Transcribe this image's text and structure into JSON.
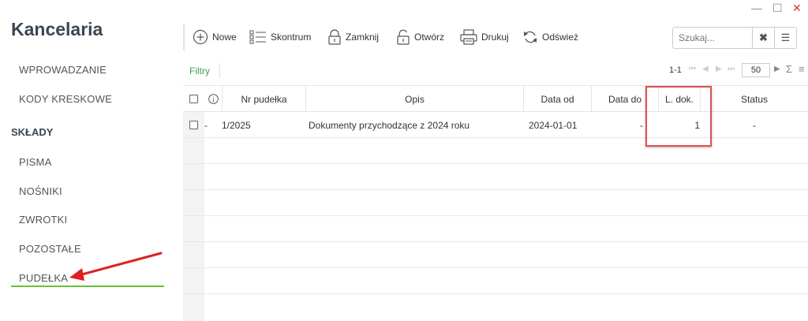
{
  "app": {
    "title": "Kancelaria"
  },
  "window": {
    "minimize": "—",
    "maximize": "☐",
    "close": "✕"
  },
  "sidebar": {
    "items": [
      {
        "label": "WPROWADZANIE"
      },
      {
        "label": "KODY KRESKOWE"
      }
    ],
    "section": "SKŁADY",
    "subitems": [
      {
        "label": "PISMA"
      },
      {
        "label": "NOŚNIKI"
      },
      {
        "label": "ZWROTKI"
      },
      {
        "label": "POZOSTAŁE"
      },
      {
        "label": "PUDEŁKA",
        "active": true
      }
    ]
  },
  "toolbar": {
    "new": "Nowe",
    "inventory": "Skontrum",
    "close": "Zamknij",
    "open": "Otwórz",
    "print": "Drukuj",
    "refresh": "Odśwież",
    "search_placeholder": "Szukaj...",
    "search_clear": "✖",
    "search_menu": "☰"
  },
  "filterbar": {
    "filters": "Filtry",
    "range": "1-1",
    "page_size": "50",
    "sum_icon": "Σ",
    "lines_icon": "≡"
  },
  "table": {
    "columns": {
      "info": "i",
      "number": "Nr pudełka",
      "description": "Opis",
      "date_from": "Data od",
      "date_to": "Data do",
      "doc_count": "L. dok.",
      "status": "Status"
    },
    "rows": [
      {
        "marker": "-",
        "number": "1/2025",
        "description": "Dokumenty przychodzące z 2024 roku",
        "date_from": "2024-01-01",
        "date_to": "-",
        "doc_count": "1",
        "status": "-"
      }
    ]
  },
  "colors": {
    "accent_green": "#6cbf3a",
    "highlight_red": "#e05050",
    "arrow_red": "#e02020"
  }
}
